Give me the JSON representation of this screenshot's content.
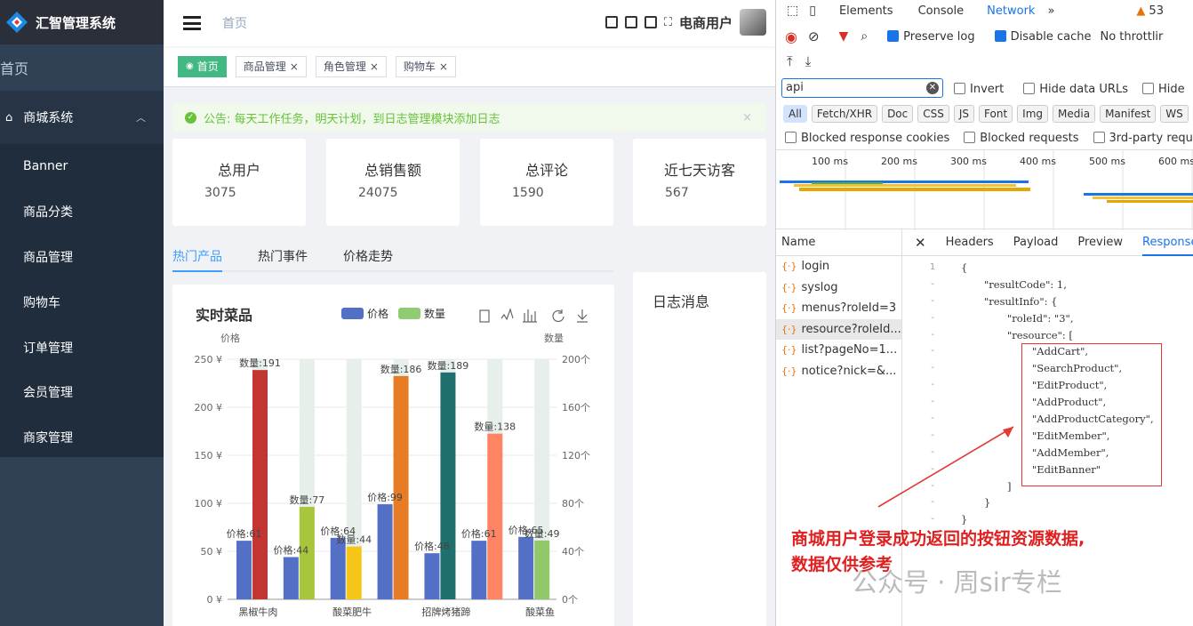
{
  "app": {
    "title": "汇智管理系统",
    "home_label": "首页",
    "menu_group": "商城系统",
    "menu_items": [
      "Banner",
      "商品分类",
      "商品管理",
      "购物车",
      "订单管理",
      "会员管理",
      "商家管理"
    ]
  },
  "navbar": {
    "breadcrumb": "首页",
    "user_name": "电商用户"
  },
  "tags": [
    {
      "label": "首页",
      "active": true
    },
    {
      "label": "商品管理",
      "close": "×"
    },
    {
      "label": "角色管理",
      "close": "×"
    },
    {
      "label": "购物车",
      "close": "×"
    }
  ],
  "notice": {
    "text": "公告: 每天工作任务，明天计划，到日志管理模块添加日志",
    "close": "×"
  },
  "stats": [
    {
      "title": "总用户",
      "value": "3075"
    },
    {
      "title": "总销售额",
      "value": "24075"
    },
    {
      "title": "总评论",
      "value": "1590"
    },
    {
      "title": "近七天访客",
      "value": "567"
    }
  ],
  "tabs": [
    "热门产品",
    "热门事件",
    "价格走势"
  ],
  "log_panel": {
    "title": "日志消息"
  },
  "chart_data": {
    "type": "bar",
    "title": "实时菜品",
    "legend": [
      "价格",
      "数量"
    ],
    "ylabel_left": "价格",
    "ylabel_right": "数量",
    "left_axis": {
      "range": [
        0,
        250
      ],
      "ticks": [
        "0 ¥",
        "50 ¥",
        "100 ¥",
        "150 ¥",
        "200 ¥",
        "250 ¥"
      ]
    },
    "right_axis": {
      "range": [
        0,
        200
      ],
      "ticks": [
        "0个",
        "40个",
        "80个",
        "120个",
        "160个",
        "200个"
      ]
    },
    "categories": [
      "黑椒牛肉",
      "",
      "酸菜肥牛",
      "",
      "招牌烤猪蹄",
      "",
      "酸菜鱼"
    ],
    "series": [
      {
        "name": "价格",
        "values": [
          61,
          44,
          64,
          99,
          48,
          61,
          65
        ],
        "labels": [
          "价格:61",
          "价格:44",
          "价格:64",
          "价格:99",
          "价格:48",
          "价格:61",
          "价格:65"
        ]
      },
      {
        "name": "数量",
        "values": [
          191,
          77,
          44,
          186,
          189,
          138,
          49
        ],
        "labels": [
          "数量:191",
          "数量:77",
          "数量:44",
          "数量:186",
          "数量:189",
          "数量:138",
          "数量:49"
        ]
      }
    ],
    "colors": {
      "price": "#5470c6",
      "qty": [
        "#c23531",
        "#a8c63c",
        "#f5c518",
        "#e87c25",
        "#1f6f6f",
        "#fe8463",
        "#91c96a"
      ],
      "legend_qty": "#91cc75",
      "shadow": "#e6efe9"
    }
  },
  "devtools": {
    "tabs": [
      "Elements",
      "Console",
      "Network"
    ],
    "more": "»",
    "warn_count": "53",
    "preserve_log": "Preserve log",
    "disable_cache": "Disable cache",
    "throttling": "No throttlir",
    "filter_value": "api",
    "invert": "Invert",
    "hide_data_urls": "Hide data URLs",
    "hide": "Hide",
    "type_filters": [
      "All",
      "Fetch/XHR",
      "Doc",
      "CSS",
      "JS",
      "Font",
      "Img",
      "Media",
      "Manifest",
      "WS"
    ],
    "blocked_cookies": "Blocked response cookies",
    "blocked_requests": "Blocked requests",
    "third_party": "3rd-party requ",
    "timeline_ticks": [
      "100 ms",
      "200 ms",
      "300 ms",
      "400 ms",
      "500 ms",
      "600 ms"
    ],
    "name_header": "Name",
    "requests": [
      "login",
      "syslog",
      "menus?roleId=3",
      "resource?roleId...",
      "list?pageNo=1...",
      "notice?nick=&..."
    ],
    "detail_tabs": [
      "Headers",
      "Payload",
      "Preview",
      "Response"
    ],
    "response_lines": [
      {
        "n": "1",
        "t": "{"
      },
      {
        "n": "-",
        "t": "\"resultCode\": 1,"
      },
      {
        "n": "-",
        "t": "\"resultInfo\": {"
      },
      {
        "n": "-",
        "t": "\"roleId\": \"3\","
      },
      {
        "n": "-",
        "t": "\"resource\": ["
      },
      {
        "n": "-",
        "t": "\"AddCart\","
      },
      {
        "n": "-",
        "t": "\"SearchProduct\","
      },
      {
        "n": "-",
        "t": "\"EditProduct\","
      },
      {
        "n": "-",
        "t": "\"AddProduct\","
      },
      {
        "n": "-",
        "t": "\"AddProductCategory\","
      },
      {
        "n": "-",
        "t": "\"EditMember\","
      },
      {
        "n": "-",
        "t": "\"AddMember\","
      },
      {
        "n": "-",
        "t": "\"EditBanner\""
      },
      {
        "n": "-",
        "t": "]"
      },
      {
        "n": "-",
        "t": "}"
      },
      {
        "n": "-",
        "t": "}"
      }
    ]
  },
  "annotation": {
    "line1": "商城用户登录成功返回的按钮资源数据,",
    "line2": "数据仅供参考"
  },
  "watermark": "公众号 · 周sir专栏"
}
